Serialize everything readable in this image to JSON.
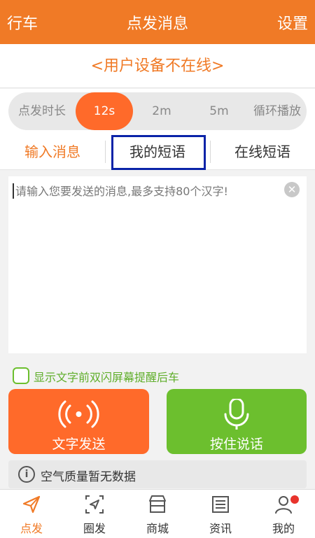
{
  "topbar": {
    "left": "行车",
    "title": "点发消息",
    "right": "设置"
  },
  "status": {
    "text": "<用户设备不在线>"
  },
  "duration": {
    "label": "点发时长",
    "options": [
      "12s",
      "2m",
      "5m"
    ],
    "selected": "12s",
    "loop": "循环播放"
  },
  "tabs": {
    "input": "输入消息",
    "phrases": "我的短语",
    "online": "在线短语"
  },
  "message": {
    "placeholder": "请输入您要发送的消息,最多支持80个汉字!",
    "value": ""
  },
  "flash": {
    "label": "显示文字前双闪屏幕提醒后车",
    "checked": false
  },
  "buttons": {
    "text_send": "文字发送",
    "hold_talk": "按住说话"
  },
  "air_quality": {
    "text": "空气质量暂无数据"
  },
  "nav": {
    "items": [
      {
        "label": "点发",
        "icon": "send-icon",
        "active": true
      },
      {
        "label": "圈发",
        "icon": "circle-send-icon",
        "active": false
      },
      {
        "label": "商城",
        "icon": "store-icon",
        "active": false
      },
      {
        "label": "资讯",
        "icon": "news-icon",
        "active": false
      },
      {
        "label": "我的",
        "icon": "user-icon",
        "active": false
      }
    ]
  },
  "colors": {
    "brand": "#f07a26",
    "send_button": "#ff6a2a",
    "voice_button": "#6cbf2e",
    "highlight": "#0a23a8",
    "badge": "#e8332c"
  }
}
